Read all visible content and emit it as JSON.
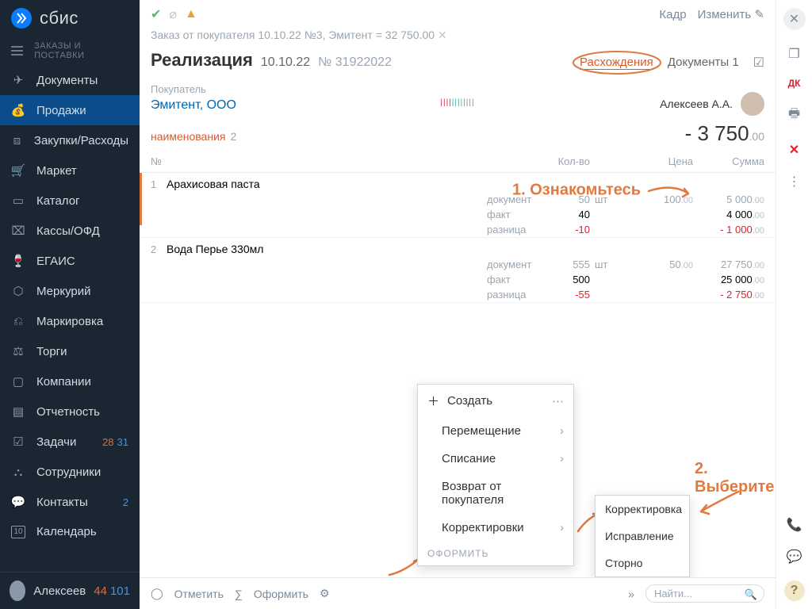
{
  "brand": "сбис",
  "section_label": "ЗАКАЗЫ И ПОСТАВКИ",
  "nav": [
    {
      "label": "Документы"
    },
    {
      "label": "Продажи"
    },
    {
      "label": "Закупки/Расходы"
    },
    {
      "label": "Маркет"
    },
    {
      "label": "Каталог"
    },
    {
      "label": "Кассы/ОФД"
    },
    {
      "label": "ЕГАИС"
    },
    {
      "label": "Меркурий"
    },
    {
      "label": "Маркировка"
    },
    {
      "label": "Торги"
    },
    {
      "label": "Компании"
    },
    {
      "label": "Отчетность"
    },
    {
      "label": "Задачи",
      "badge_red": "28",
      "badge_blue": "31"
    },
    {
      "label": "Сотрудники"
    },
    {
      "label": "Контакты",
      "badge_blue": "2"
    },
    {
      "label": "Календарь",
      "cal": "10"
    }
  ],
  "user_sidebar": {
    "name": "Алексеев",
    "badge_red": "44",
    "badge_blue": "101"
  },
  "topbar": {
    "kadr": "Кадр",
    "edit": "Изменить"
  },
  "breadcrumb": "Заказ от покупателя 10.10.22 №3, Эмитент = 32 750.00",
  "title": "Реализация",
  "title_date": "10.10.22",
  "title_num_prefix": "№",
  "title_num": "31922022",
  "tabs": {
    "discrepancies": "Расхождения",
    "documents": "Документы",
    "documents_count": "1"
  },
  "buyer": {
    "label": "Покупатель",
    "name": "Эмитент, ООО"
  },
  "person": {
    "name": "Алексеев А.А."
  },
  "barcode": "||||||||||||||||",
  "summary": {
    "label": "наименования",
    "count": "2",
    "total_int": "- 3 750",
    "total_cents": ".00"
  },
  "columns": {
    "num": "№",
    "qty": "Кол-во",
    "price": "Цена",
    "sum": "Сумма"
  },
  "row_labels": {
    "doc": "документ",
    "fact": "факт",
    "diff": "разница",
    "unit": "шт"
  },
  "items": [
    {
      "idx": "1",
      "name": "Арахисовая паста",
      "doc": {
        "qty": "50",
        "price_int": "100",
        "price_c": ".00",
        "sum_int": "5 000",
        "sum_c": ".00"
      },
      "fact": {
        "qty": "40",
        "sum_int": "4 000",
        "sum_c": ".00"
      },
      "diff": {
        "qty": "-10",
        "sum_int": "- 1 000",
        "sum_c": ".00"
      }
    },
    {
      "idx": "2",
      "name": "Вода Перье 330мл",
      "doc": {
        "qty": "555",
        "price_int": "50",
        "price_c": ".00",
        "sum_int": "27 750",
        "sum_c": ".00"
      },
      "fact": {
        "qty": "500",
        "sum_int": "25 000",
        "sum_c": ".00"
      },
      "diff": {
        "qty": "-55",
        "sum_int": "- 2 750",
        "sum_c": ".00"
      }
    }
  ],
  "create_menu": {
    "header": "Создать",
    "items": [
      "Перемещение",
      "Списание",
      "Возврат от покупателя",
      "Корректировки"
    ],
    "footer": "ОФОРМИТЬ"
  },
  "sub_menu": [
    "Корректировка",
    "Исправление",
    "Сторно"
  ],
  "footer": {
    "mark": "Отметить",
    "process": "Оформить",
    "search_placeholder": "Найти..."
  },
  "rail": {
    "dk": "ДК"
  },
  "annotations": {
    "one": "1. Ознакомьтесь",
    "two": "2. Выберите"
  }
}
